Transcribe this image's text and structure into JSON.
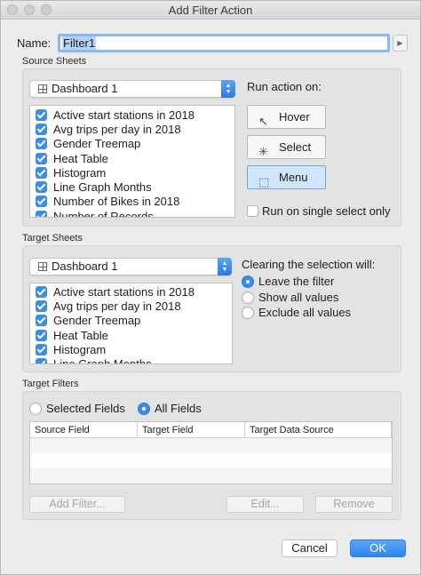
{
  "window": {
    "title": "Add Filter Action"
  },
  "name_field": {
    "label": "Name:",
    "value": "Filter1",
    "button_glyph": "▶"
  },
  "source_sheets": {
    "heading": "Source Sheets",
    "select_value": "Dashboard 1",
    "items": [
      "Active start stations in 2018",
      "Avg trips per day in 2018",
      "Gender Treemap",
      "Heat Table",
      "Histogram",
      "Line Graph Months",
      "Number of Bikes in 2018",
      "Number of Records"
    ],
    "run_action_label": "Run action on:",
    "actions": [
      {
        "label": "Hover",
        "icon": "pointer-icon",
        "glyph": "↖"
      },
      {
        "label": "Select",
        "icon": "select-pointer-icon",
        "glyph": "✳"
      },
      {
        "label": "Menu",
        "icon": "menu-pointer-icon",
        "glyph": "⬚"
      }
    ],
    "active_action": "Menu",
    "single_select_label": "Run on single select only"
  },
  "target_sheets": {
    "heading": "Target Sheets",
    "select_value": "Dashboard 1",
    "items": [
      "Active start stations in 2018",
      "Avg trips per day in 2018",
      "Gender Treemap",
      "Heat Table",
      "Histogram",
      "Line Graph Months"
    ],
    "clearing_label": "Clearing the selection will:",
    "clearing_options": [
      "Leave the filter",
      "Show all values",
      "Exclude all values"
    ],
    "clearing_selected": "Leave the filter"
  },
  "target_filters": {
    "heading": "Target Filters",
    "radio_selected_fields": "Selected Fields",
    "radio_all_fields": "All Fields",
    "selected_radio": "All Fields",
    "columns": [
      "Source Field",
      "Target Field",
      "Target Data Source"
    ],
    "buttons": {
      "add": "Add Filter...",
      "edit": "Edit...",
      "remove": "Remove"
    }
  },
  "footer": {
    "cancel": "Cancel",
    "ok": "OK"
  },
  "colors": {
    "accent": "#3b8de8",
    "ok_button": "#2f86f0",
    "active_action_bg": "#cfe6fb"
  }
}
